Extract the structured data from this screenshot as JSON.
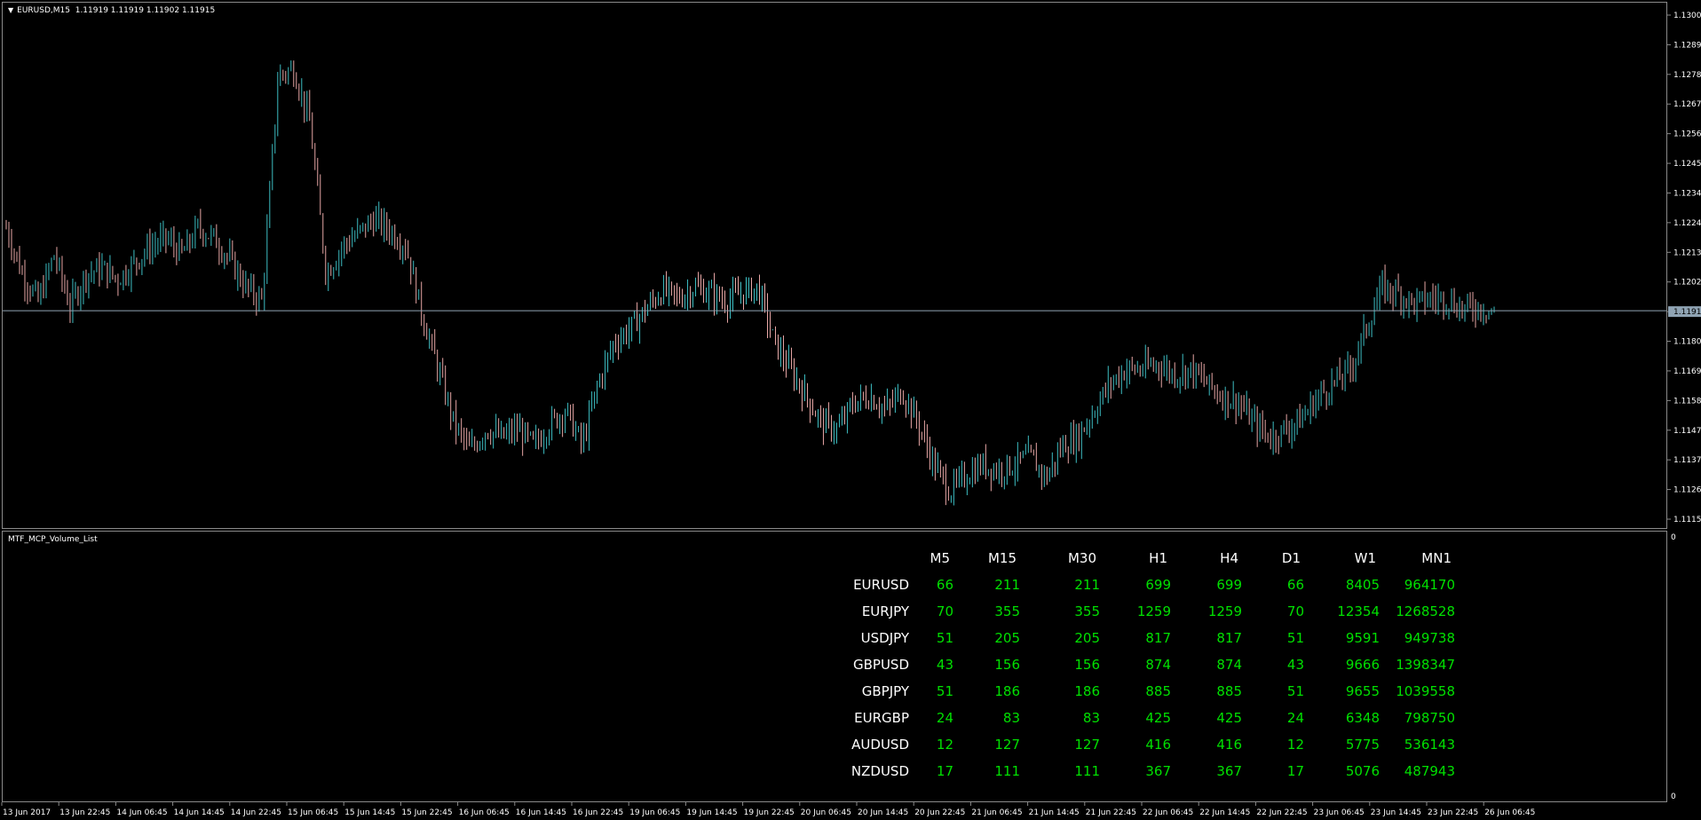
{
  "chart": {
    "title": "EURUSD,M15  1.11919 1.11919 1.11902 1.11915",
    "current_price": "1.11915",
    "colors": {
      "bull": "#3dbfc4",
      "bear": "#e8a7a6",
      "grid": "#8a8a8a",
      "current_line": "#8fa3b3",
      "text": "#ffffff",
      "value": "#00e000"
    }
  },
  "price_axis": {
    "labels": [
      "1.13000",
      "1.12890",
      "1.12780",
      "1.12670",
      "1.12565",
      "1.12455",
      "1.12345",
      "1.12240",
      "1.12130",
      "1.12020",
      "1.11915",
      "1.11805",
      "1.11695",
      "1.11585",
      "1.11475",
      "1.11370",
      "1.11260",
      "1.11150"
    ]
  },
  "time_axis": {
    "labels": [
      "13 Jun 2017",
      "13 Jun 22:45",
      "14 Jun 06:45",
      "14 Jun 14:45",
      "14 Jun 22:45",
      "15 Jun 06:45",
      "15 Jun 14:45",
      "15 Jun 22:45",
      "16 Jun 06:45",
      "16 Jun 14:45",
      "16 Jun 22:45",
      "19 Jun 06:45",
      "19 Jun 14:45",
      "19 Jun 22:45",
      "20 Jun 06:45",
      "20 Jun 14:45",
      "20 Jun 22:45",
      "21 Jun 06:45",
      "21 Jun 14:45",
      "21 Jun 22:45",
      "22 Jun 06:45",
      "22 Jun 14:45",
      "22 Jun 22:45",
      "23 Jun 06:45",
      "23 Jun 14:45",
      "23 Jun 22:45",
      "26 Jun 06:45"
    ]
  },
  "indicator": {
    "title": "MTF_MCP_Volume_List",
    "scale_top": "0",
    "scale_bottom": "0",
    "headers": [
      "M5",
      "M15",
      "M30",
      "H1",
      "H4",
      "D1",
      "W1",
      "MN1"
    ],
    "rows": [
      {
        "symbol": "EURUSD",
        "values": [
          "66",
          "211",
          "211",
          "699",
          "699",
          "66",
          "8405",
          "964170"
        ]
      },
      {
        "symbol": "EURJPY",
        "values": [
          "70",
          "355",
          "355",
          "1259",
          "1259",
          "70",
          "12354",
          "1268528"
        ]
      },
      {
        "symbol": "USDJPY",
        "values": [
          "51",
          "205",
          "205",
          "817",
          "817",
          "51",
          "9591",
          "949738"
        ]
      },
      {
        "symbol": "GBPUSD",
        "values": [
          "43",
          "156",
          "156",
          "874",
          "874",
          "43",
          "9666",
          "1398347"
        ]
      },
      {
        "symbol": "GBPJPY",
        "values": [
          "51",
          "186",
          "186",
          "885",
          "885",
          "51",
          "9655",
          "1039558"
        ]
      },
      {
        "symbol": "EURGBP",
        "values": [
          "24",
          "83",
          "83",
          "425",
          "425",
          "24",
          "6348",
          "798750"
        ]
      },
      {
        "symbol": "AUDUSD",
        "values": [
          "12",
          "127",
          "127",
          "416",
          "416",
          "12",
          "5775",
          "536143"
        ]
      },
      {
        "symbol": "NZDUSD",
        "values": [
          "17",
          "111",
          "111",
          "367",
          "367",
          "17",
          "5076",
          "487943"
        ]
      }
    ]
  },
  "chart_data": {
    "type": "line",
    "series": [
      {
        "values": [
          1.1222,
          1.1205,
          1.1195,
          1.1212,
          1.1193,
          1.1205,
          1.1207,
          1.1203,
          1.1209,
          1.1215,
          1.1218,
          1.1212,
          1.1222,
          1.1218,
          1.121,
          1.12,
          1.1195,
          1.1278,
          1.128,
          1.126,
          1.1205,
          1.1215,
          1.122,
          1.1225,
          1.1221,
          1.1215,
          1.119,
          1.117,
          1.115,
          1.114,
          1.1148,
          1.1145,
          1.1148,
          1.1142,
          1.115,
          1.1155,
          1.1142,
          1.1165,
          1.118,
          1.1185,
          1.1192,
          1.1199,
          1.1196,
          1.12,
          1.1198,
          1.1195,
          1.1198,
          1.12,
          1.118,
          1.117,
          1.116,
          1.115,
          1.1148,
          1.1158,
          1.116,
          1.1155,
          1.1162,
          1.115,
          1.1135,
          1.1125,
          1.1131,
          1.1135,
          1.1133,
          1.1135,
          1.1138,
          1.113,
          1.1142,
          1.1145,
          1.1155,
          1.1165,
          1.117,
          1.117,
          1.1172,
          1.1168,
          1.117,
          1.1165,
          1.116,
          1.1158,
          1.115,
          1.1145,
          1.1148,
          1.1152,
          1.116,
          1.1165,
          1.117,
          1.1185,
          1.12,
          1.1198,
          1.1194,
          1.1196,
          1.1196,
          1.1192,
          1.1193,
          1.1191
        ],
        "ylim": [
          1.1115,
          1.13
        ]
      }
    ]
  }
}
